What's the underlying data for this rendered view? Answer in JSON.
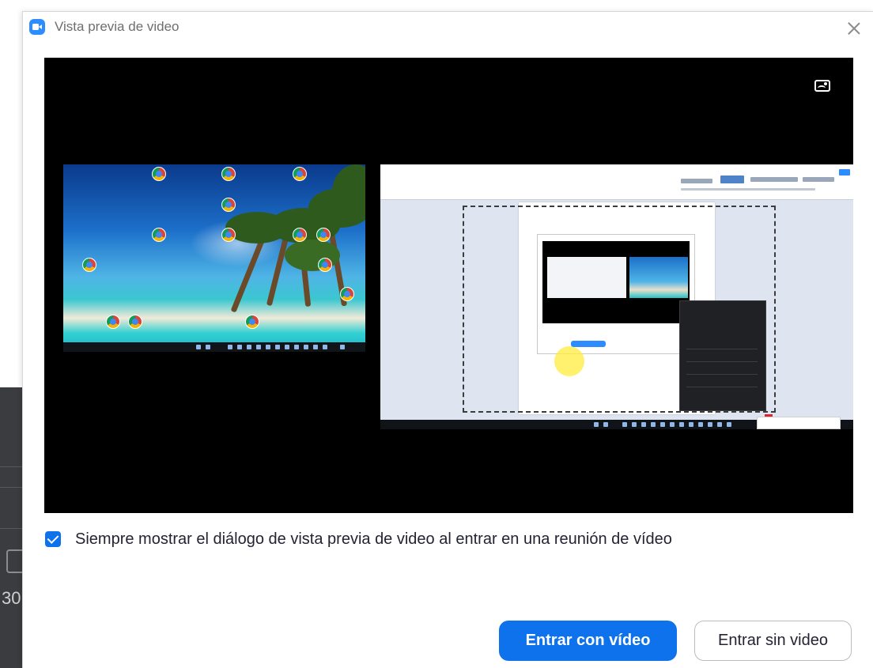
{
  "background_app": {
    "partial_text": "30"
  },
  "dialog": {
    "title": "Vista previa de video",
    "icons": {
      "app": "zoom-camera-icon",
      "close": "close-icon",
      "background_picker": "image-background-icon"
    }
  },
  "preview": {
    "description": "screen share preview of two monitors"
  },
  "options": {
    "always_show_preview": {
      "checked": true,
      "label": "Siempre mostrar el diálogo de vista previa de video al entrar en una reunión de vídeo"
    }
  },
  "actions": {
    "join_with_video": "Entrar con vídeo",
    "join_without_video": "Entrar sin video"
  },
  "colors": {
    "accent": "#0e72ed",
    "title_text": "#6e6e73",
    "body_text": "#232333",
    "preview_bg": "#000000"
  }
}
